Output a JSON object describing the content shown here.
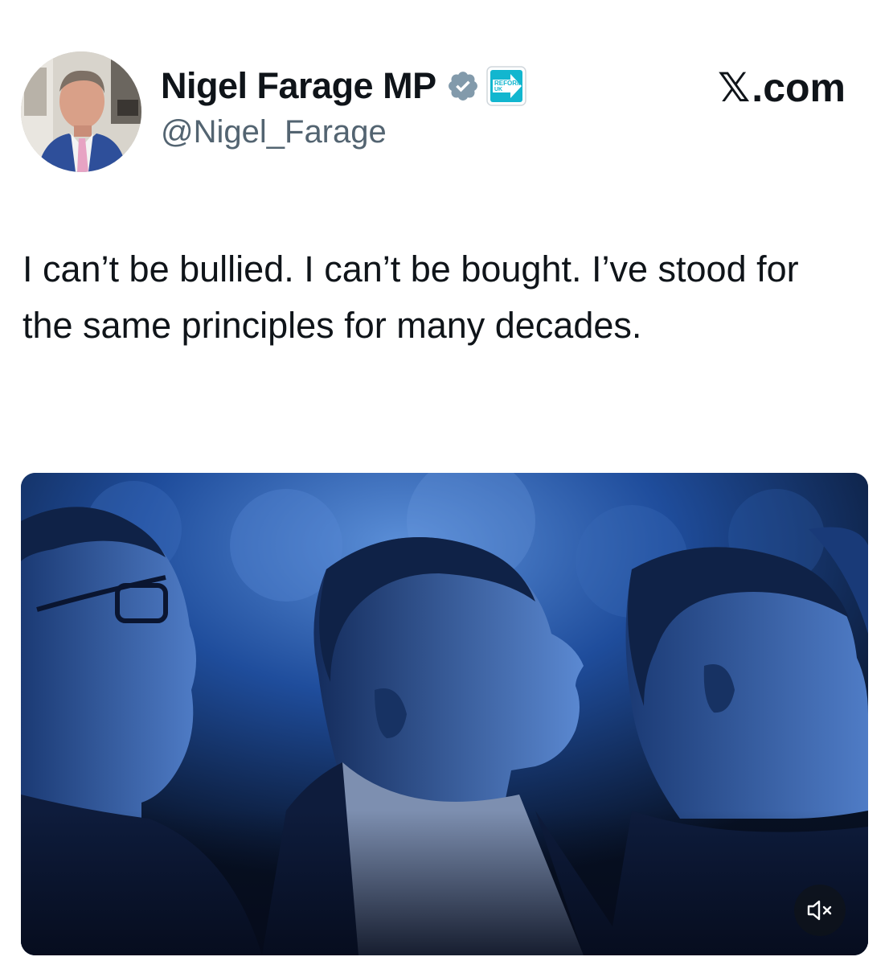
{
  "author": {
    "display_name": "Nigel Farage MP",
    "handle": "@Nigel_Farage",
    "verified_icon": "verified-badge-icon",
    "affiliate_badge": {
      "icon": "reform-uk-logo",
      "text_line1": "REFORM",
      "text_line2": "UK",
      "color": "#12B6CF"
    }
  },
  "source": {
    "logo_text": "𝕏",
    "domain_text": ".com"
  },
  "post": {
    "text": "I can’t be bullied. I can’t be bought. I’ve stood for the same principles for many decades."
  },
  "media": {
    "type": "video",
    "description_icon": "video-thumbnail",
    "mute_icon": "speaker-muted-icon"
  },
  "colors": {
    "text_primary": "#0f1419",
    "text_secondary": "#536471",
    "verified_badge": "#829aab",
    "video_tint": "#1a3f8a"
  }
}
